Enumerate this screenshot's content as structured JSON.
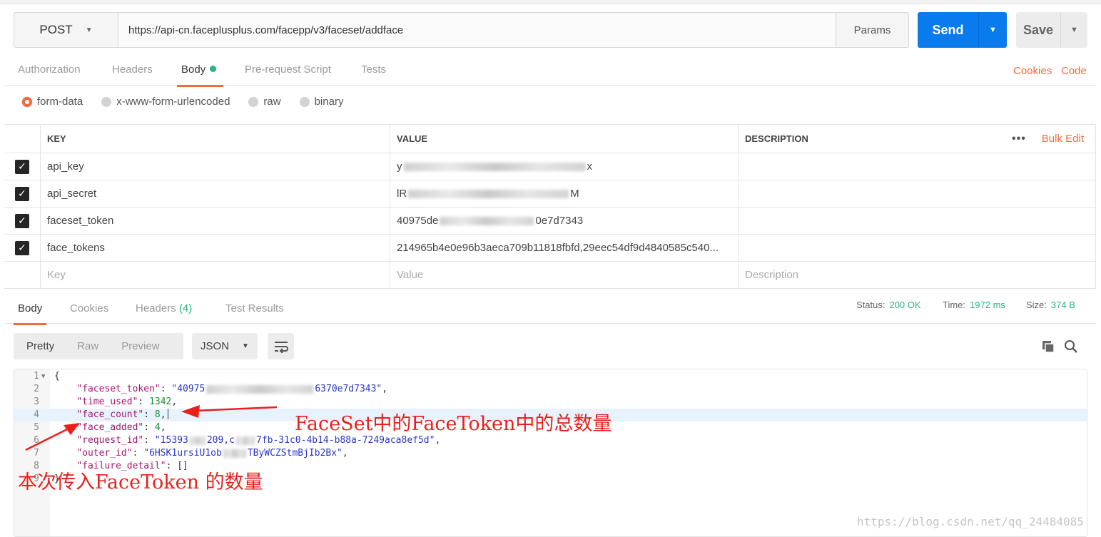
{
  "request": {
    "method": "POST",
    "url": "https://api-cn.faceplusplus.com/facepp/v3/faceset/addface",
    "params_label": "Params",
    "send_label": "Send",
    "save_label": "Save"
  },
  "request_tabs": {
    "authorization": "Authorization",
    "headers": "Headers",
    "body": "Body",
    "prerequest": "Pre-request Script",
    "tests": "Tests",
    "cookies": "Cookies",
    "code": "Code"
  },
  "body_types": {
    "form_data": "form-data",
    "urlencoded": "x-www-form-urlencoded",
    "raw": "raw",
    "binary": "binary"
  },
  "params_table": {
    "headers": {
      "key": "KEY",
      "value": "VALUE",
      "description": "DESCRIPTION"
    },
    "more_label": "•••",
    "bulk_edit": "Bulk Edit",
    "rows": [
      {
        "key": "api_key",
        "value_start": "y",
        "value_end": "x"
      },
      {
        "key": "api_secret",
        "value_start": "lR",
        "value_end": "M"
      },
      {
        "key": "faceset_token",
        "value_start": "40975de",
        "value_end": "0e7d7343"
      },
      {
        "key": "face_tokens",
        "value": "214965b4e0e96b3aeca709b11818fbfd,29eec54df9d4840585c540..."
      }
    ],
    "placeholders": {
      "key": "Key",
      "value": "Value",
      "description": "Description"
    }
  },
  "response_tabs": {
    "body": "Body",
    "cookies": "Cookies",
    "headers": "Headers",
    "headers_count": "(4)",
    "test_results": "Test Results"
  },
  "status": {
    "status_label": "Status:",
    "status_value": "200 OK",
    "time_label": "Time:",
    "time_value": "1972 ms",
    "size_label": "Size:",
    "size_value": "374 B"
  },
  "response_view": {
    "pretty": "Pretty",
    "raw": "Raw",
    "preview": "Preview",
    "format": "JSON"
  },
  "response_lines": [
    {
      "n": "1",
      "parts": [
        [
          "p",
          "{"
        ]
      ]
    },
    {
      "n": "2",
      "parts": [
        [
          "p",
          "    "
        ],
        [
          "k",
          "\"faceset_token\""
        ],
        [
          "p",
          ": "
        ],
        [
          "s",
          "\"40975"
        ],
        [
          "b",
          ""
        ],
        [
          "s",
          "6370e7d7343\""
        ],
        [
          "p",
          ","
        ]
      ]
    },
    {
      "n": "3",
      "parts": [
        [
          "p",
          "    "
        ],
        [
          "k",
          "\"time_used\""
        ],
        [
          "p",
          ": "
        ],
        [
          "n",
          "1342"
        ],
        [
          "p",
          ","
        ]
      ]
    },
    {
      "n": "4",
      "parts": [
        [
          "p",
          "    "
        ],
        [
          "k",
          "\"face_count\""
        ],
        [
          "p",
          ": "
        ],
        [
          "n",
          "8"
        ],
        [
          "p",
          ","
        ],
        [
          "c",
          ""
        ]
      ]
    },
    {
      "n": "5",
      "parts": [
        [
          "p",
          "    "
        ],
        [
          "k",
          "\"face_added\""
        ],
        [
          "p",
          ": "
        ],
        [
          "n",
          "4"
        ],
        [
          "p",
          ","
        ]
      ]
    },
    {
      "n": "6",
      "parts": [
        [
          "p",
          "    "
        ],
        [
          "k",
          "\"request_id\""
        ],
        [
          "p",
          ": "
        ],
        [
          "s",
          "\"15393"
        ],
        [
          "b",
          ""
        ],
        [
          "s",
          "209,c"
        ],
        [
          "b",
          ""
        ],
        [
          "s",
          "7fb-31c0-4b14-b88a-7249aca8ef5d\""
        ],
        [
          "p",
          ","
        ]
      ]
    },
    {
      "n": "7",
      "parts": [
        [
          "p",
          "    "
        ],
        [
          "k",
          "\"outer_id\""
        ],
        [
          "p",
          ": "
        ],
        [
          "s",
          "\"6HSK1ursiU1ob"
        ],
        [
          "b",
          ""
        ],
        [
          "s",
          "TByWCZStmBjIb2Bx\""
        ],
        [
          "p",
          ","
        ]
      ]
    },
    {
      "n": "8",
      "parts": [
        [
          "p",
          "    "
        ],
        [
          "k",
          "\"failure_detail\""
        ],
        [
          "p",
          ": []"
        ]
      ]
    },
    {
      "n": "9",
      "parts": [
        [
          "p",
          "}"
        ]
      ]
    }
  ],
  "annotations": {
    "face_count_note": "FaceSet中的FaceToken中的总数量",
    "face_added_note": "本次传入FaceToken 的数量",
    "color": "#e8211b"
  },
  "watermark": "https://blog.csdn.net/qq_24484085",
  "colors": {
    "send": "#097bed",
    "accent": "#f26b3a",
    "success": "#26b47f"
  }
}
